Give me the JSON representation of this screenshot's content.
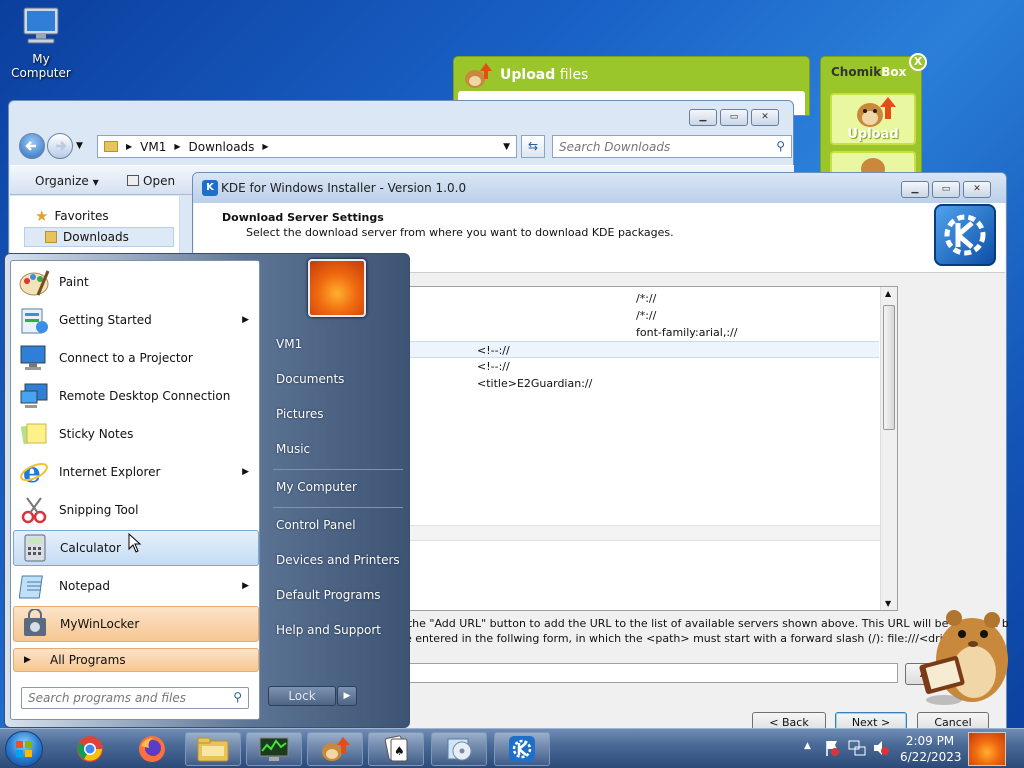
{
  "desktop": {
    "my_computer": "My Computer"
  },
  "chomik_upload": {
    "title_bold": "Upload",
    "title_rest": " files"
  },
  "chomikbox": {
    "title": "ChomikBox",
    "close": "X",
    "upload_label": "Upload"
  },
  "explorer": {
    "path": [
      "VM1",
      "Downloads"
    ],
    "search_placeholder": "Search Downloads",
    "organize": "Organize",
    "open": "Open",
    "favorites": "Favorites",
    "downloads": "Downloads"
  },
  "kde": {
    "title": "KDE for Windows Installer - Version 1.0.0",
    "heading": "Download Server Settings",
    "subheading": "Select the download server from where you want to download KDE packages.",
    "rows": [
      {
        "mid": "",
        "right": "/*://"
      },
      {
        "mid": "",
        "right": "/*://"
      },
      {
        "mid": "",
        "right": "font-family:arial,://"
      },
      {
        "mid": "<!--://",
        "right": ""
      },
      {
        "mid": "<!--://",
        "right": ""
      },
      {
        "mid": "<title>E2Guardian://",
        "right": ""
      }
    ],
    "desc1": "k the \"Add URL\" button to add the URL to the list of available servers shown above. This URL will be selected by",
    "desc2": "be entered in the follwing form, in which the <path> must start with a forward slash (/): file:///<drive>:<path",
    "add_url": "Add U",
    "back": "< Back",
    "next": "Next >",
    "cancel": "Cancel"
  },
  "start_menu": {
    "programs": [
      {
        "label": "Paint",
        "arrow": false
      },
      {
        "label": "Getting Started",
        "arrow": true
      },
      {
        "label": "Connect to a Projector",
        "arrow": false
      },
      {
        "label": "Remote Desktop Connection",
        "arrow": false
      },
      {
        "label": "Sticky Notes",
        "arrow": false
      },
      {
        "label": "Internet Explorer",
        "arrow": true
      },
      {
        "label": "Snipping Tool",
        "arrow": false
      },
      {
        "label": "Calculator",
        "arrow": false
      },
      {
        "label": "Notepad",
        "arrow": true
      },
      {
        "label": "MyWinLocker",
        "arrow": false
      }
    ],
    "all_programs": "All Programs",
    "search_placeholder": "Search programs and files",
    "right_items": [
      "VM1",
      "Documents",
      "Pictures",
      "Music",
      "My Computer",
      "Control Panel",
      "Devices and Printers",
      "Default Programs",
      "Help and Support"
    ],
    "lock": "Lock"
  },
  "taskbar": {
    "time": "2:09 PM",
    "date": "6/22/2023"
  }
}
